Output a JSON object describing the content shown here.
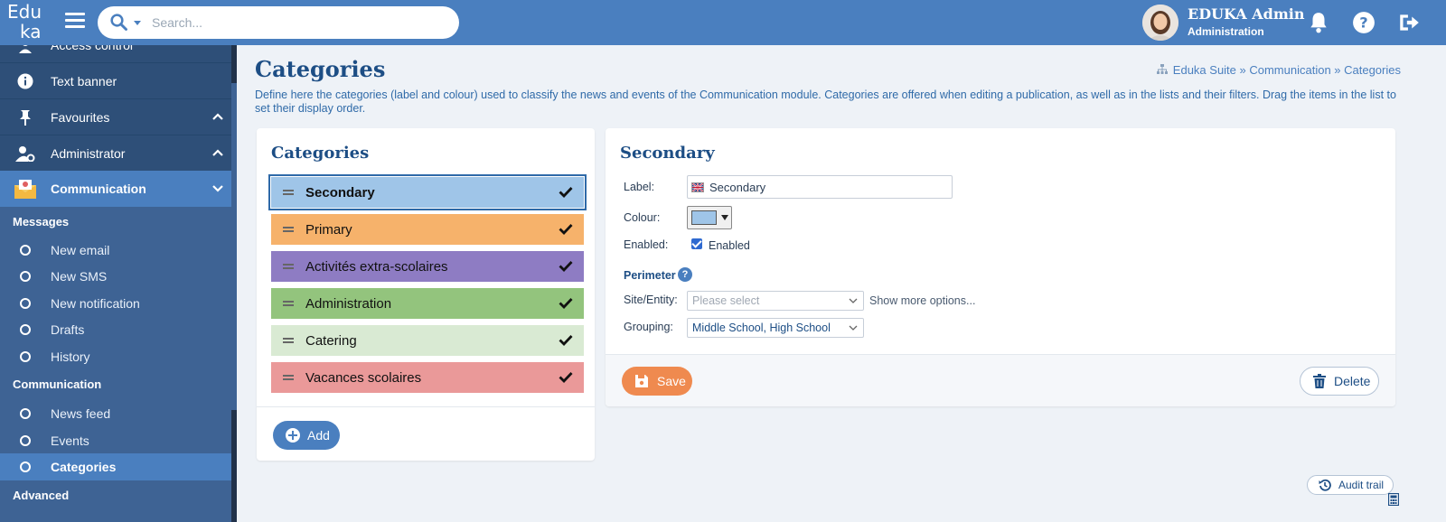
{
  "header": {
    "logo_line1": "Edu",
    "logo_line2": "ka",
    "search_placeholder": "Search...",
    "user_name": "EDUKA Admin",
    "user_role": "Administration"
  },
  "sidebar": {
    "partial_item": "Access control",
    "items": [
      {
        "label": "Text banner",
        "icon": "info-icon"
      },
      {
        "label": "Favourites",
        "icon": "pin-icon"
      },
      {
        "label": "Administrator",
        "icon": "user-gear-icon"
      },
      {
        "label": "Communication",
        "icon": "envelope-icon"
      }
    ],
    "sections": [
      {
        "title": "Messages",
        "items": [
          "New email",
          "New SMS",
          "New notification",
          "Drafts",
          "History"
        ]
      },
      {
        "title": "Communication",
        "items": [
          "News feed",
          "Events",
          "Categories"
        ]
      },
      {
        "title": "Advanced"
      }
    ],
    "active_item": "Categories"
  },
  "page": {
    "title": "Categories",
    "breadcrumb": "Eduka Suite » Communication » Categories",
    "description": "Define here the categories (label and colour) used to classify the news and events of the Communication module. Categories are offered when editing a publication, as well as in the lists and their filters. Drag the items in the list to set their display order."
  },
  "categories_card": {
    "title": "Categories",
    "items": [
      {
        "label": "Secondary",
        "color": "#9fc5e8",
        "selected": true
      },
      {
        "label": "Primary",
        "color": "#f6b26b"
      },
      {
        "label": "Activités extra-scolaires",
        "color": "#8e7cc3"
      },
      {
        "label": "Administration",
        "color": "#93c47d"
      },
      {
        "label": "Catering",
        "color": "#d9ead3"
      },
      {
        "label": "Vacances scolaires",
        "color": "#ea9999"
      }
    ],
    "add_label": "Add"
  },
  "detail_card": {
    "title": "Secondary",
    "label_label": "Label:",
    "label_value": "Secondary",
    "colour_label": "Colour:",
    "colour_value": "#9fc5e8",
    "enabled_label": "Enabled:",
    "enabled_checkbox_label": "Enabled",
    "perimeter_label": "Perimeter",
    "site_label": "Site/Entity:",
    "site_placeholder": "Please select",
    "show_more": "Show more options...",
    "grouping_label": "Grouping:",
    "grouping_value": "Middle School, High School",
    "save_label": "Save",
    "delete_label": "Delete"
  },
  "footer": {
    "audit_label": "Audit trail"
  },
  "colors": {
    "brand": "#4a7fbf",
    "sidebar": "#3e6394",
    "accent_save": "#ef8a4f"
  }
}
